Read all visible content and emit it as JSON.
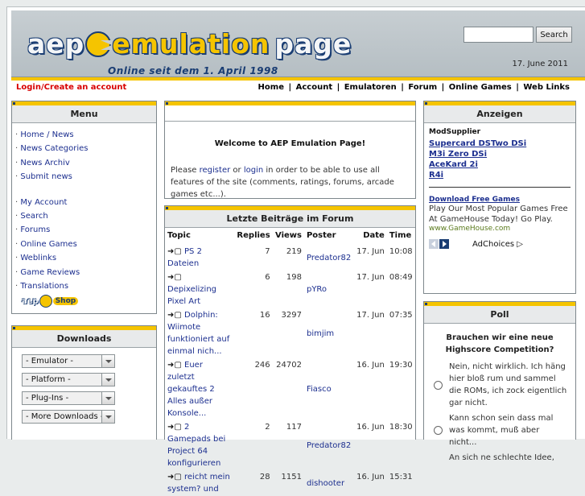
{
  "header": {
    "logo_left": "aep",
    "logo_mid": "emulation",
    "logo_right": "page",
    "tagline": "Online seit dem 1. April 1998",
    "search_button": "Search",
    "date": "17. June 2011"
  },
  "nav": {
    "login": "Login/Create an account",
    "links": [
      "Home",
      "Account",
      "Emulatoren",
      "Forum",
      "Online Games",
      "Web Links"
    ],
    "separator": "|"
  },
  "menu": {
    "title": "Menu",
    "group1": [
      "Home / News",
      "News Categories",
      "News Archiv",
      "Submit news"
    ],
    "group2": [
      "My Account",
      "Search",
      "Forums",
      "Online Games",
      "Weblinks",
      "Game Reviews",
      "Translations"
    ],
    "shop": {
      "a": "aep",
      "s": "Shop"
    }
  },
  "downloads": {
    "title": "Downloads",
    "selects": [
      "- Emulator -",
      "- Platform -",
      "- Plug-Ins -",
      "- More Downloads -"
    ]
  },
  "welcome": {
    "title": "Welcome to AEP Emulation Page!",
    "text_before": "Please ",
    "register": "register",
    "or": " or ",
    "login": "login",
    "text_after": " in order to be able to use all features of the site (comments, ratings, forums, arcade games etc...)."
  },
  "forum": {
    "title": "Letzte Beiträge im Forum",
    "columns": [
      "Topic",
      "Replies",
      "Views",
      "Poster",
      "Date",
      "Time"
    ],
    "rows": [
      {
        "topic": "PS 2 Dateien",
        "replies": "7",
        "views": "219",
        "poster": "Predator82",
        "date": "17. Jun",
        "time": "10:08"
      },
      {
        "topic": "Depixelizing Pixel Art",
        "replies": "6",
        "views": "198",
        "poster": "pYRo",
        "date": "17. Jun",
        "time": "08:49"
      },
      {
        "topic": "Dolphin: Wiimote funktioniert auf einmal nich...",
        "replies": "16",
        "views": "3297",
        "poster": "bimjim",
        "date": "17. Jun",
        "time": "07:35"
      },
      {
        "topic": "Euer zuletzt gekauftes 2 Alles außer Konsole...",
        "replies": "246",
        "views": "24702",
        "poster": "Fiasco",
        "date": "16. Jun",
        "time": "19:30"
      },
      {
        "topic": "2 Gamepads bei Project 64 konfigurieren",
        "replies": "2",
        "views": "117",
        "poster": "Predator82",
        "date": "16. Jun",
        "time": "18:30"
      },
      {
        "topic": "reicht mein system? und",
        "replies": "28",
        "views": "1151",
        "poster": "dishooter",
        "date": "16. Jun",
        "time": "15:31"
      }
    ]
  },
  "ads": {
    "title": "Anzeigen",
    "sponsor": "ModSupplier",
    "links": [
      "Supercard DSTwo DSi",
      "M3i Zero DSi",
      "AceKard 2i",
      "R4i"
    ],
    "promo_title": "Download Free Games",
    "promo_text": "Play Our Most Popular Games Free At GameHouse Today! Go Play.",
    "promo_url": "www.GameHouse.com",
    "adchoices": "AdChoices ▷"
  },
  "poll": {
    "title": "Poll",
    "question": "Brauchen wir eine neue Highscore Competition?",
    "options": [
      "Nein, nicht wirklich. Ich häng hier bloß rum und sammel die ROMs, ich zock eigentlich gar nicht.",
      "Kann schon sein dass mal was kommt, muß aber nicht...",
      "An sich ne schlechte Idee,"
    ]
  },
  "colors": {
    "accent": "#f5c400",
    "brand": "#1a3d73",
    "link": "#1c2f8f",
    "login": "#d80000"
  }
}
